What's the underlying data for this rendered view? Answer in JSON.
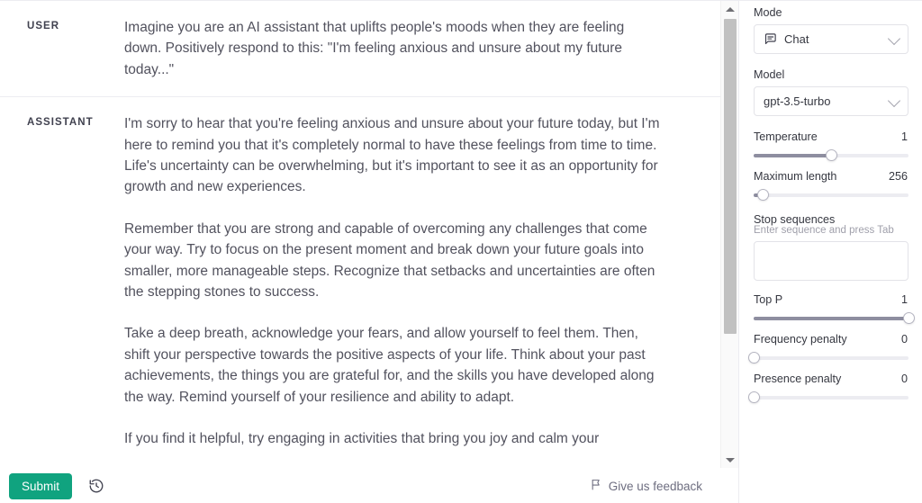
{
  "conversation": {
    "turns": [
      {
        "role": "USER",
        "paragraphs": [
          "Imagine you are an AI assistant that uplifts people's moods when they are feeling down. Positively respond to this: \"I'm feeling anxious and unsure about my future today...\""
        ]
      },
      {
        "role": "ASSISTANT",
        "paragraphs": [
          "I'm sorry to hear that you're feeling anxious and unsure about your future today, but I'm here to remind you that it's completely normal to have these feelings from time to time. Life's uncertainty can be overwhelming, but it's important to see it as an opportunity for growth and new experiences.",
          "Remember that you are strong and capable of overcoming any challenges that come your way. Try to focus on the present moment and break down your future goals into smaller, more manageable steps. Recognize that setbacks and uncertainties are often the stepping stones to success.",
          "Take a deep breath, acknowledge your fears, and allow yourself to feel them. Then, shift your perspective towards the positive aspects of your life. Think about your past achievements, the things you are grateful for, and the skills you have developed along the way. Remind yourself of your resilience and ability to adapt.",
          "If you find it helpful, try engaging in activities that bring you joy and calm your"
        ]
      }
    ]
  },
  "bottombar": {
    "submit_label": "Submit",
    "history_icon": "history-clock-icon",
    "feedback_label": "Give us feedback",
    "feedback_icon": "flag-icon"
  },
  "scrollbar": {
    "up_icon": "triangle-up-icon",
    "down_icon": "triangle-down-icon"
  },
  "sidebar": {
    "mode": {
      "label": "Mode",
      "value": "Chat",
      "icon": "chat-bubble-icon",
      "chevron_icon": "chevron-down-icon"
    },
    "model": {
      "label": "Model",
      "value": "gpt-3.5-turbo",
      "chevron_icon": "chevron-down-icon"
    },
    "temperature": {
      "label": "Temperature",
      "value": "1",
      "percent": 50
    },
    "maximum_length": {
      "label": "Maximum length",
      "value": "256",
      "percent": 6
    },
    "stop_sequences": {
      "label": "Stop sequences",
      "hint": "Enter sequence and press Tab",
      "value": "",
      "placeholder": ""
    },
    "top_p": {
      "label": "Top P",
      "value": "1",
      "percent": 100
    },
    "frequency_penalty": {
      "label": "Frequency penalty",
      "value": "0",
      "percent": 0
    },
    "presence_penalty": {
      "label": "Presence penalty",
      "value": "0",
      "percent": 0
    }
  },
  "colors": {
    "accent": "#10a37f",
    "slider_fill": "#8e8ea0",
    "track": "#ececf1",
    "border": "#ececf1"
  }
}
